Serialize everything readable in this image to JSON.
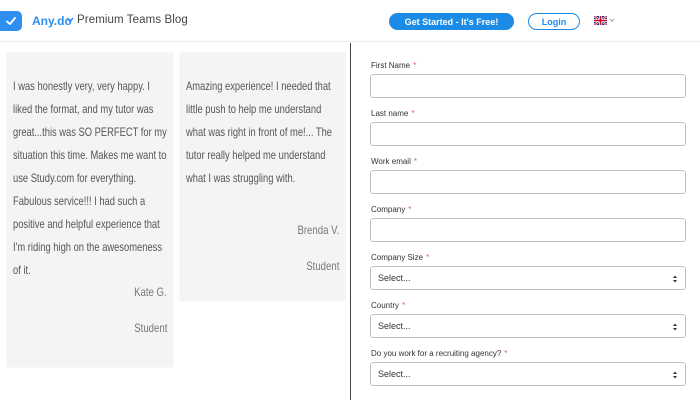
{
  "header": {
    "brand": "Any.do",
    "sub_brand": "Premium Teams Blog",
    "get_started": "Get Started - It's Free!",
    "login": "Login"
  },
  "testimonials": [
    {
      "text": "I was honestly very, very happy. I liked the format, and my tutor was great...this was SO PERFECT for my situation this time. Makes me want to use Study.com for everything. Fabulous service!!! I had such a positive and helpful experience that I'm riding high on the awesomeness of it.",
      "author": "Kate G.",
      "role": "Student"
    },
    {
      "text": "Amazing experience! I needed that little push to help me understand what was right in front of me!... The tutor really helped me understand what I was struggling with.",
      "author": "Brenda V.",
      "role": "Student"
    }
  ],
  "form": {
    "first_name_label": "First Name",
    "last_name_label": "Last name",
    "work_email_label": "Work email",
    "company_label": "Company",
    "company_size_label": "Company Size",
    "company_size_value": "Select...",
    "country_label": "Country",
    "country_value": "Select...",
    "recruiting_label": "Do you work for a recruiting agency?",
    "recruiting_value": "Select...",
    "required_mark": "*"
  },
  "colors": {
    "brand_blue": "#2f8ff0",
    "button_blue": "#1b8be8",
    "required_red": "#e45454"
  }
}
